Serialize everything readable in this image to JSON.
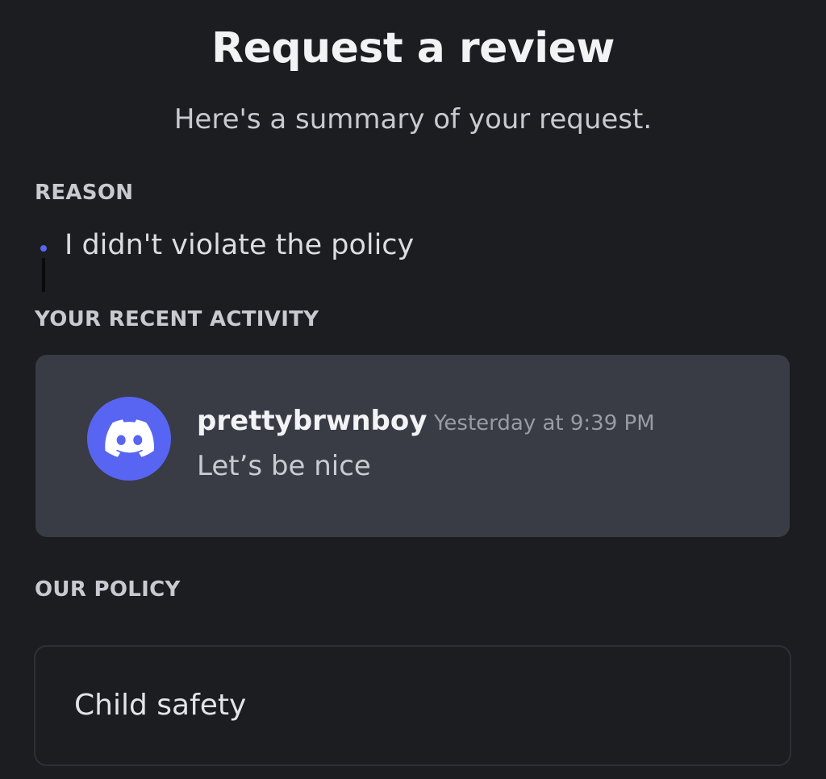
{
  "header": {
    "title": "Request a review",
    "subtitle": "Here's a summary of your request."
  },
  "reason": {
    "label": "REASON",
    "items": [
      "I didn't violate the policy"
    ]
  },
  "activity": {
    "label": "YOUR RECENT ACTIVITY",
    "message": {
      "username": "prettybrwnboy",
      "timestamp": "Yesterday at 9:39 PM",
      "content": "Let’s be nice",
      "avatar_icon": "discord-logo-icon"
    }
  },
  "policy": {
    "label": "OUR POLICY",
    "name": "Child safety"
  },
  "colors": {
    "background": "#1c1d21",
    "card": "#393b45",
    "accent": "#5865f2"
  }
}
